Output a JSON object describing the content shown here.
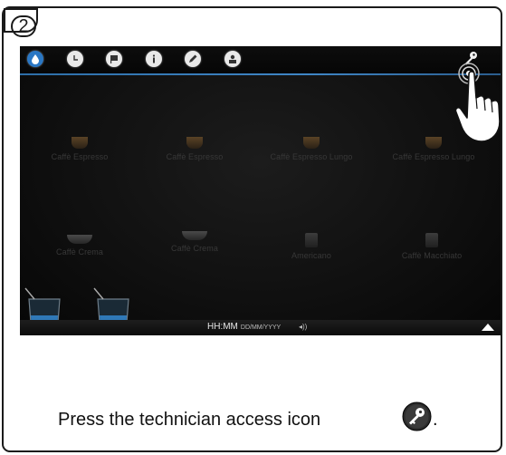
{
  "step": {
    "number": "2"
  },
  "screen": {
    "toolbar_icons": [
      "water-drop-icon",
      "clock-icon",
      "flag-icon",
      "info-icon",
      "pencil-icon",
      "user-icon"
    ],
    "technician_icon": "key-icon",
    "products_row1": [
      "Caffè Espresso",
      "Caffè Espresso",
      "Caffè Espresso Lungo",
      "Caffè Espresso Lungo"
    ],
    "products_row2": [
      "Caffè Crema",
      "Caffè Crema",
      "Americano",
      "Caffè Macchiato"
    ],
    "bottom_bar": {
      "time": "HH:MM",
      "date": "DD/MM/YYYY",
      "volume": "◂))"
    },
    "accent_color": "#3f86c6"
  },
  "instruction": {
    "text": "Press the technician access icon",
    "period": "."
  }
}
